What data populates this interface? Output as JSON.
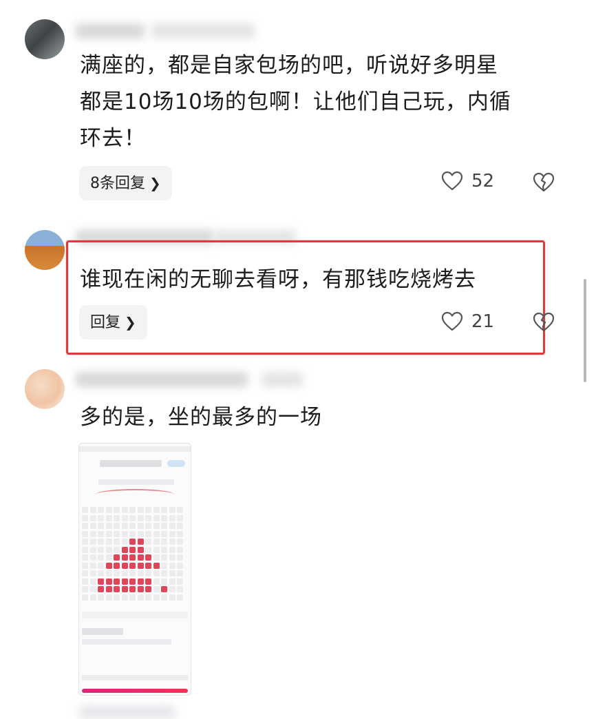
{
  "comments": [
    {
      "text_lines": [
        "满座的，都是自家包场的吧，听说好多明星",
        "都是10场10场的包啊！让他们自己玩，内循",
        "环去！"
      ],
      "reply_label": "8条回复",
      "like_count": "52"
    },
    {
      "text": "谁现在闲的无聊去看呀，有那钱吃烧烤去",
      "reply_label": "回复",
      "like_count": "21"
    },
    {
      "text": "多的是，坐的最多的一场"
    }
  ],
  "colors": {
    "highlight_border": "#e0383e",
    "seat_sold": "#e0465a",
    "pill_bg": "#f3f3f5"
  },
  "icons": [
    "heart-icon",
    "broken-heart-icon",
    "chevron-right-icon"
  ]
}
